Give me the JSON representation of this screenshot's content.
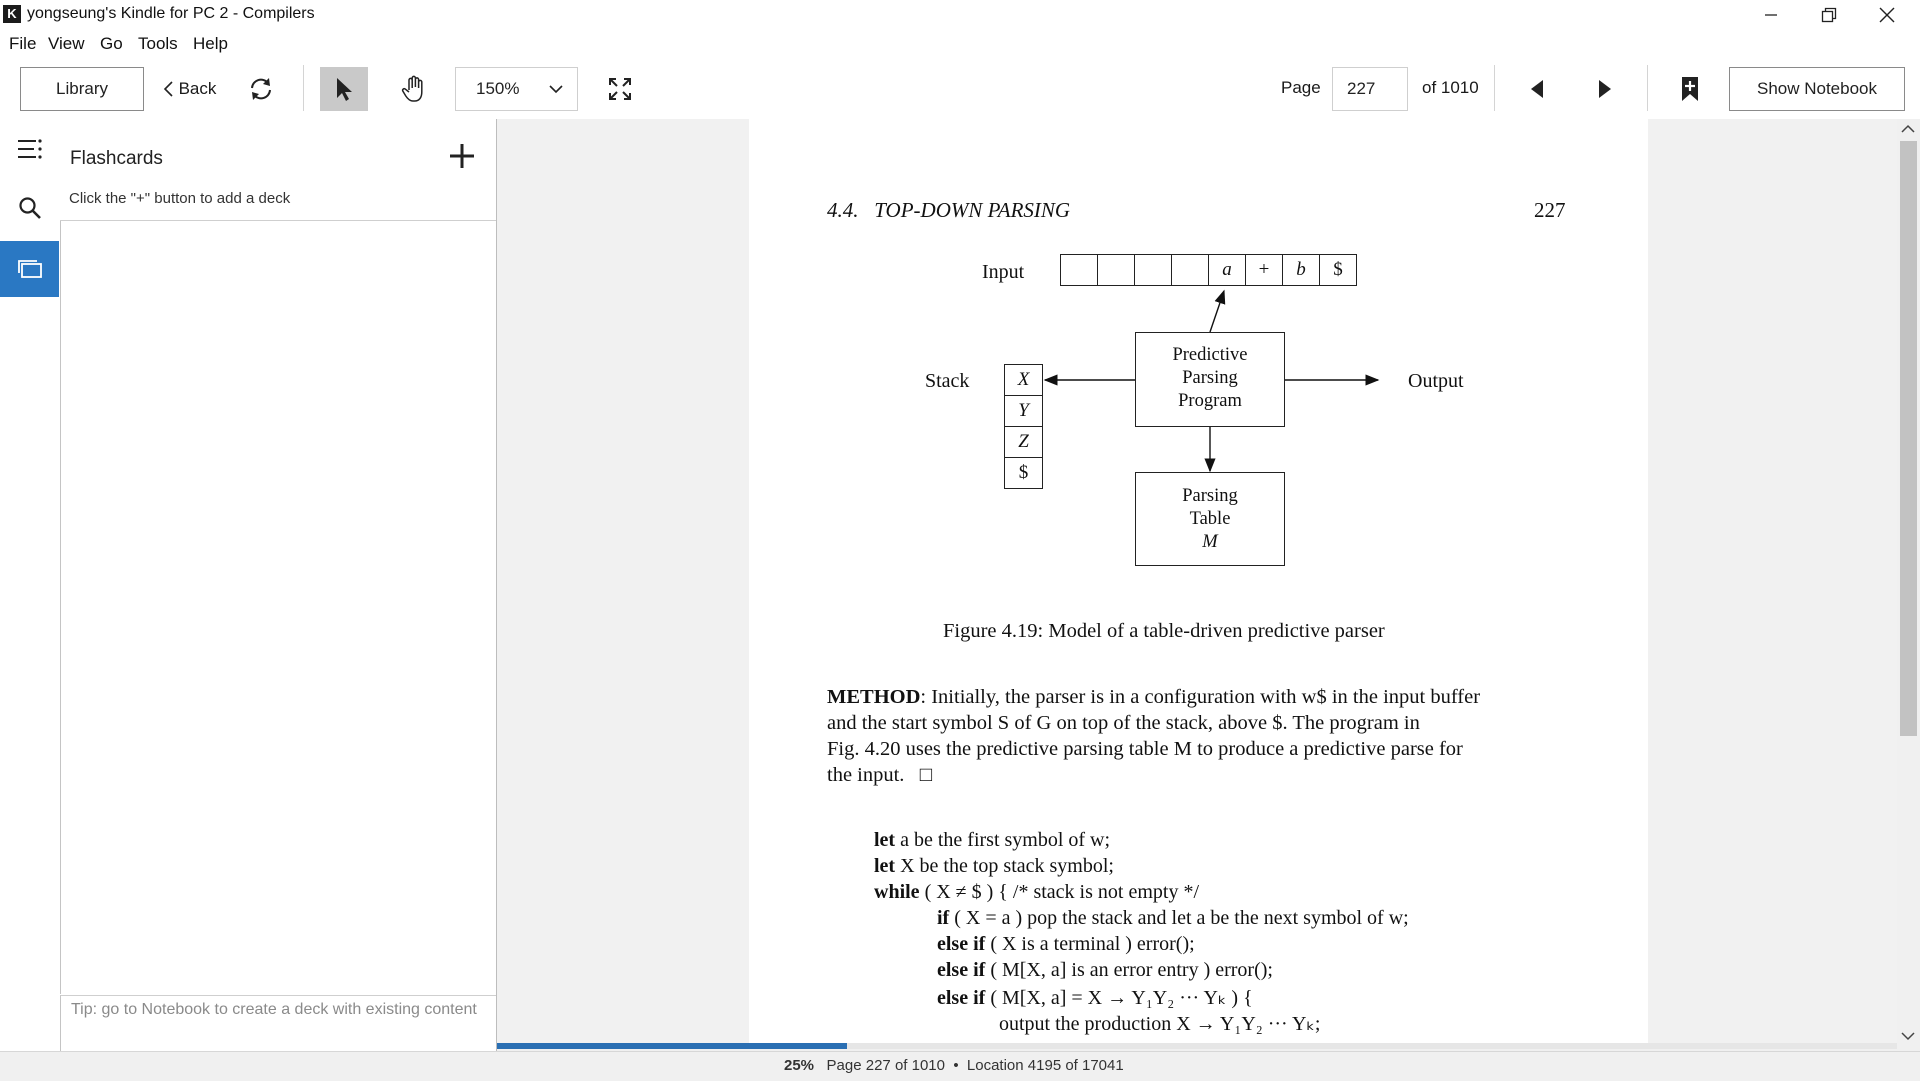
{
  "window": {
    "title": "yongseung's Kindle for PC 2 - Compilers",
    "app_icon_glyph": "K"
  },
  "menu": [
    "File",
    "View",
    "Go",
    "Tools",
    "Help"
  ],
  "toolbar": {
    "library_label": "Library",
    "back_label": "Back",
    "zoom_value": "150%",
    "page_label": "Page",
    "page_input": "227",
    "page_total": "of 1010",
    "show_notebook_label": "Show Notebook"
  },
  "flashcards": {
    "title": "Flashcards",
    "hint": "Click the \"+\" button to add a deck",
    "tip": "Tip: go to Notebook to create a deck with existing content"
  },
  "page": {
    "running_head": "4.4.   TOP-DOWN PARSING",
    "page_number": "227",
    "diagram": {
      "input_label": "Input",
      "input_cells": [
        "",
        "",
        "",
        "",
        "a",
        "+",
        "b",
        "$"
      ],
      "stack_label": "Stack",
      "stack_cells": [
        "X",
        "Y",
        "Z",
        "$"
      ],
      "program_box": [
        "Predictive",
        "Parsing",
        "Program"
      ],
      "table_box": [
        "Parsing",
        "Table",
        "M"
      ],
      "output_label": "Output"
    },
    "caption": "Figure 4.19: Model of a table-driven predictive parser",
    "method_label": "METHOD",
    "method_lines": [
      ": Initially, the parser is in a configuration with w$ in the input buffer",
      "and the start symbol S of G on top of the stack, above $.  The program in",
      "Fig. 4.20 uses the predictive parsing table M to produce a predictive parse for",
      "the input.   □"
    ],
    "code": [
      {
        "kw": "let",
        "rest": " a be the first symbol of w;"
      },
      {
        "kw": "let",
        "rest": " X be the top stack symbol;"
      },
      {
        "kw": "while",
        "rest": " ( X ≠ $ ) { /* stack is not empty */"
      },
      {
        "kw": "if",
        "rest": " ( X = a ) pop the stack and let a be the next symbol of w;"
      },
      {
        "kw": "else if",
        "rest": " ( X is a terminal ) error();"
      },
      {
        "kw": "else if",
        "rest": " ( M[X, a] is an error entry ) error();"
      },
      {
        "kw": "else if",
        "rest": " ( M[X, a] = X → Y₁Y₂ ··· Yₖ ) {"
      },
      {
        "kw": "",
        "rest": "output the production X → Y₁Y₂ ··· Yₖ;"
      }
    ]
  },
  "status": {
    "percent": "25%",
    "text": "Page 227 of 1010  •  Location 4195 of 17041"
  },
  "reading_progress": 0.25
}
